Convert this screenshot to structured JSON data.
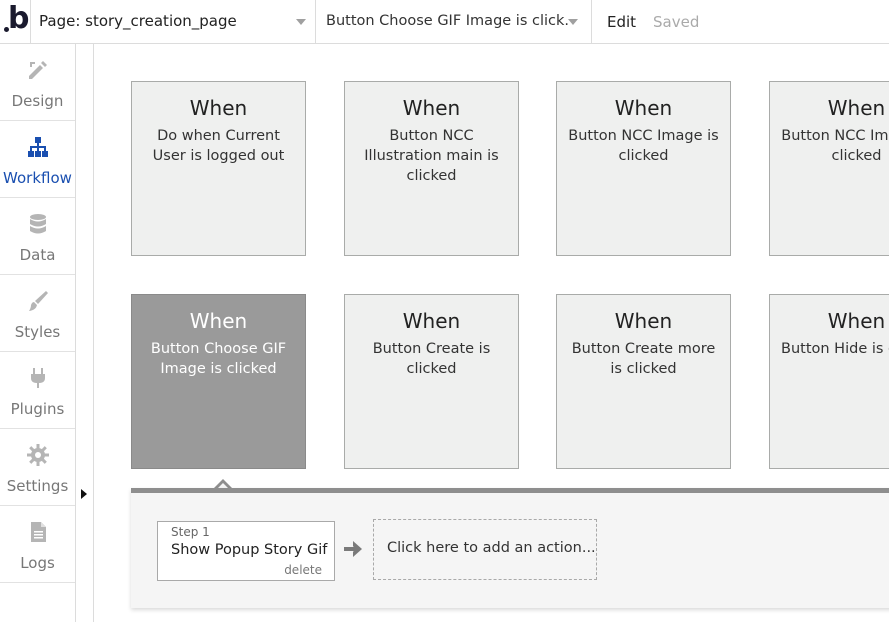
{
  "topbar": {
    "logo_letter": "b",
    "page_label": "Page: story_creation_page",
    "event_label": "Button Choose GIF Image is click...",
    "edit_label": "Edit",
    "saved_label": "Saved"
  },
  "sidebar": {
    "items": [
      {
        "label": "Design",
        "icon": "design-icon"
      },
      {
        "label": "Workflow",
        "icon": "workflow-icon",
        "active": true
      },
      {
        "label": "Data",
        "icon": "database-icon"
      },
      {
        "label": "Styles",
        "icon": "brush-icon"
      },
      {
        "label": "Plugins",
        "icon": "plug-icon"
      },
      {
        "label": "Settings",
        "icon": "gear-icon"
      },
      {
        "label": "Logs",
        "icon": "document-icon"
      }
    ]
  },
  "events": [
    {
      "when": "When",
      "desc": "Do when Current User is logged out"
    },
    {
      "when": "When",
      "desc": "Button NCC Illustration main is clicked"
    },
    {
      "when": "When",
      "desc": "Button NCC Image is clicked"
    },
    {
      "when": "When",
      "desc": "Button NCC Image is clicked"
    },
    {
      "when": "When",
      "desc": "Button Choose GIF Image is clicked",
      "selected": true
    },
    {
      "when": "When",
      "desc": "Button Create is clicked"
    },
    {
      "when": "When",
      "desc": "Button Create more is clicked"
    },
    {
      "when": "When",
      "desc": "Button Hide is clicked"
    }
  ],
  "actions": {
    "step_num": "Step 1",
    "step_name": "Show Popup Story Gif",
    "delete_label": "delete",
    "add_action_label": "Click here to add an action..."
  },
  "colors": {
    "accent": "#1a4fb0",
    "selected_card": "#9a9a9a",
    "card_bg": "#eff0ef"
  }
}
